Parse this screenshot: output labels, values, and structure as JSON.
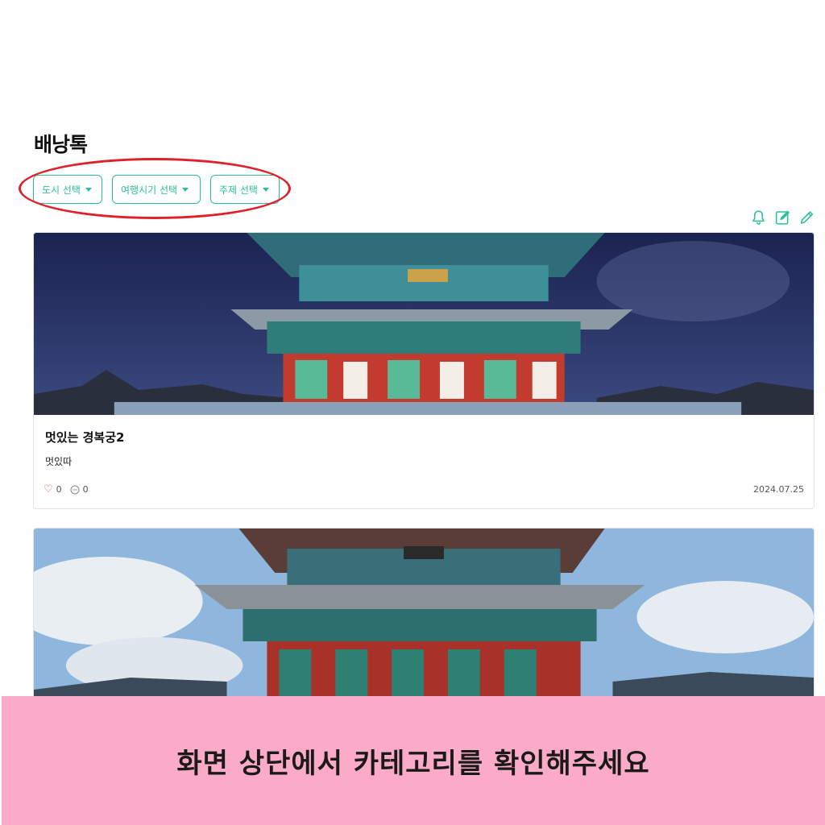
{
  "header": {
    "title": "배낭톡"
  },
  "filters": [
    {
      "label": "도시 선택"
    },
    {
      "label": "여행시기 선택"
    },
    {
      "label": "주제 선택"
    }
  ],
  "actions": {
    "icons": [
      "bell-icon",
      "edit-note-icon",
      "pencil-icon"
    ],
    "accent_color": "#2bbf9a"
  },
  "posts": [
    {
      "title": "멋있는 경복궁2",
      "text": "멋있따",
      "likes": "0",
      "comments": "0",
      "date": "2024.07.25"
    }
  ],
  "banner": {
    "text": "화면 상단에서 카테고리를 확인해주세요",
    "color": "#fbaac8"
  },
  "annotation": {
    "color": "#e0202a"
  }
}
